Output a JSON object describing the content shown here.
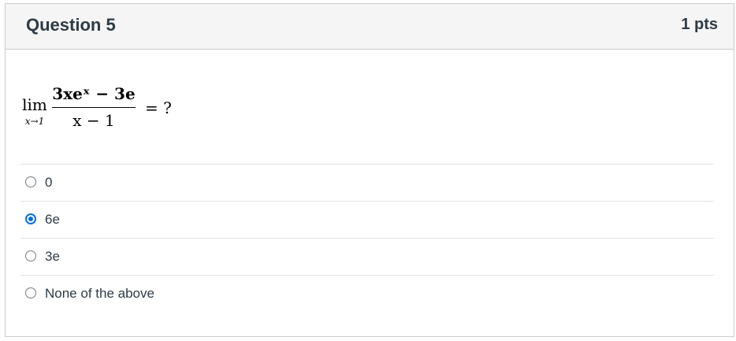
{
  "question": {
    "title": "Question 5",
    "points": "1 pts"
  },
  "formula": {
    "lim": "lim",
    "lim_sub": "x→1",
    "numerator": "3xeˣ − 3e",
    "denominator": "x − 1",
    "rhs": "= ?"
  },
  "answers": [
    {
      "label": "0",
      "selected": false
    },
    {
      "label": "6e",
      "selected": true
    },
    {
      "label": "3e",
      "selected": false
    },
    {
      "label": "None of the above",
      "selected": false
    }
  ],
  "colors": {
    "accent": "#0b6edc",
    "header_bg": "#f5f5f5",
    "border": "#c7cdd1",
    "text": "#2d3b45"
  }
}
